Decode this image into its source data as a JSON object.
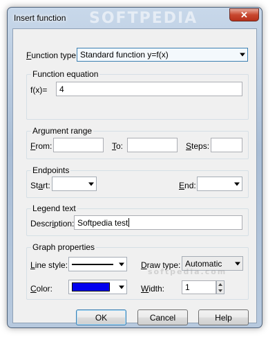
{
  "window": {
    "title": "Insert function",
    "close_glyph": "✕"
  },
  "watermark": {
    "header": "SOFTPEDIA",
    "footer": "softpedia.com"
  },
  "function_type": {
    "label_prefix": "",
    "label_u": "F",
    "label_rest": "unction type:",
    "value": "Standard function   y=f(x)"
  },
  "function_equation": {
    "title": "Function equation",
    "prefix_label": "f(x)=",
    "value": "4"
  },
  "argument_range": {
    "title": "Argument range",
    "from_u": "F",
    "from_rest": "rom:",
    "to_u": "T",
    "to_rest": "o:",
    "steps_u": "S",
    "steps_rest": "teps:",
    "from_value": "",
    "to_value": "",
    "steps_value": ""
  },
  "endpoints": {
    "title": "Endpoints",
    "start_pre": "St",
    "start_u": "a",
    "start_rest": "rt:",
    "end_u": "E",
    "end_rest": "nd:",
    "start_value": "",
    "end_value": ""
  },
  "legend_text": {
    "title": "Legend text",
    "description_pre": "Descr",
    "description_u": "i",
    "description_rest": "ption:",
    "value": "Softpedia test"
  },
  "graph_properties": {
    "title": "Graph properties",
    "line_style_u": "L",
    "line_style_rest": "ine style:",
    "draw_type_u": "D",
    "draw_type_rest": "raw type:",
    "draw_type_value": "Automatic",
    "color_u": "C",
    "color_rest": "olor:",
    "color_value": "#0000ee",
    "width_u": "W",
    "width_rest": "idth:",
    "width_value": "1"
  },
  "buttons": {
    "ok": "OK",
    "cancel": "Cancel",
    "help": "Help"
  }
}
